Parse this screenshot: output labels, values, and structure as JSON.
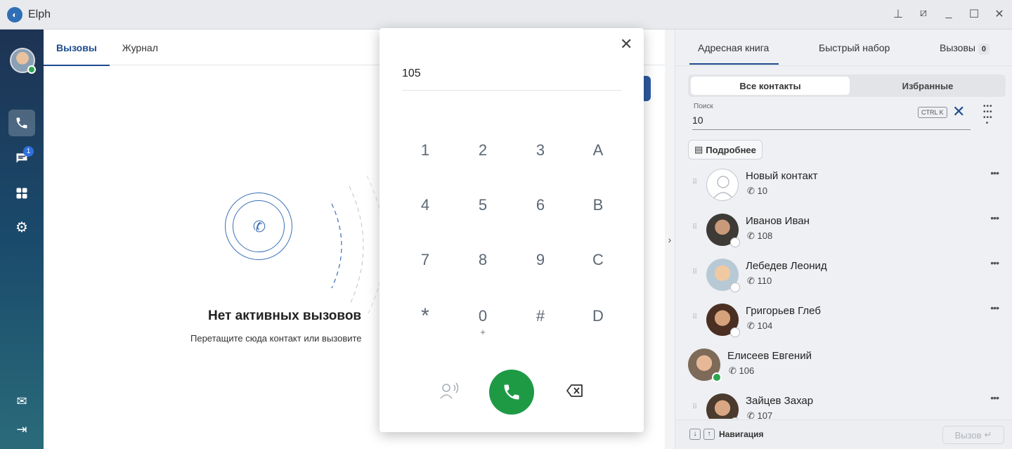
{
  "app": {
    "title": "Elph"
  },
  "sidebar": {
    "chat_badge": "1"
  },
  "left": {
    "tabs": [
      {
        "label": "Вызовы"
      },
      {
        "label": "Журнал"
      }
    ],
    "empty_title": "Нет активных вызовов",
    "empty_sub": "Перетащите сюда контакт или вызовите"
  },
  "right": {
    "tabs": [
      {
        "label": "Адресная книга"
      },
      {
        "label": "Быстрый набор"
      },
      {
        "label": "Вызовы"
      }
    ],
    "calls_count": "0",
    "segments": {
      "all": "Все контакты",
      "favorites": "Избранные"
    },
    "search": {
      "label": "Поиск",
      "value": "10",
      "shortcut": "CTRL K"
    },
    "more_label": "Подробнее",
    "contacts": [
      {
        "name": "Новый контакт",
        "number": "10"
      },
      {
        "name": "Иванов Иван",
        "number": "108"
      },
      {
        "name": "Лебедев Леонид",
        "number": "110"
      },
      {
        "name": "Григорьев Глеб",
        "number": "104"
      },
      {
        "name": "Елисеев Евгений",
        "number": "106"
      },
      {
        "name": "Зайцев Захар",
        "number": "107"
      }
    ],
    "footer": {
      "nav_label": "Навигация",
      "call_label": "Вызов"
    }
  },
  "dialer": {
    "value": "105",
    "keys": [
      {
        "main": "1",
        "sub": ""
      },
      {
        "main": "2",
        "sub": ""
      },
      {
        "main": "3",
        "sub": ""
      },
      {
        "main": "A",
        "sub": ""
      },
      {
        "main": "4",
        "sub": ""
      },
      {
        "main": "5",
        "sub": ""
      },
      {
        "main": "6",
        "sub": ""
      },
      {
        "main": "B",
        "sub": ""
      },
      {
        "main": "7",
        "sub": ""
      },
      {
        "main": "8",
        "sub": ""
      },
      {
        "main": "9",
        "sub": ""
      },
      {
        "main": "C",
        "sub": ""
      },
      {
        "main": "*",
        "sub": ""
      },
      {
        "main": "0",
        "sub": "+"
      },
      {
        "main": "#",
        "sub": ""
      },
      {
        "main": "D",
        "sub": ""
      }
    ]
  },
  "colors": {
    "accent": "#1e4b8f",
    "call_green": "#1e9a45",
    "online": "#2ea44f"
  }
}
